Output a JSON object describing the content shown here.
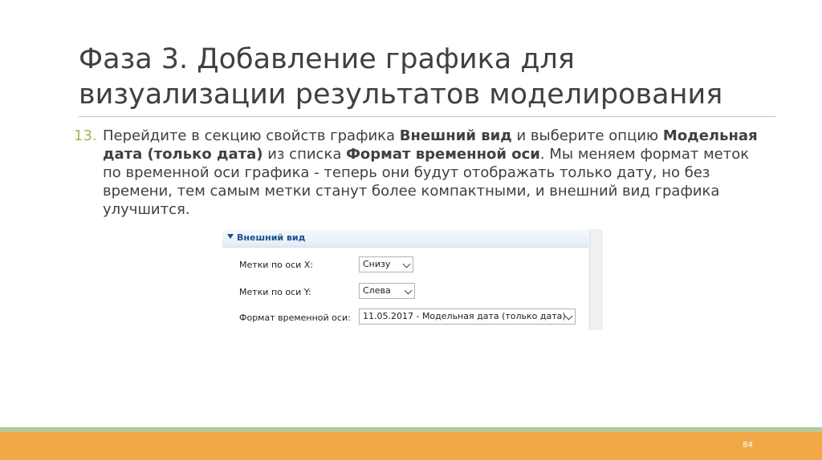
{
  "slide": {
    "title": "Фаза 3. Добавление графика для визуализации результатов моделирования",
    "page_number": "84"
  },
  "step": {
    "number": "13.",
    "t1": "Перейдите в секцию свойств графика ",
    "b1": "Внешний вид",
    "t2": " и выберите опцию ",
    "b2": "Модельная дата (только дата)",
    "t3": " из списка ",
    "b3": "Формат временной оси",
    "t4": ". Мы меняем формат меток по временной оси графика - теперь они будут отображать только дату, но без времени, тем самым метки станут более компактными, и внешний вид графика улучшится."
  },
  "panel": {
    "header": "Внешний вид",
    "rows": [
      {
        "label": "Метки по оси X:",
        "value": "Снизу"
      },
      {
        "label": "Метки по оси Y:",
        "value": "Слева"
      },
      {
        "label": "Формат временной оси:",
        "value": "11.05.2017 - Модельная дата (только дата)"
      }
    ]
  },
  "colors": {
    "accent_green": "#9bbb59",
    "footer_orange": "#f3a848",
    "title_text": "#404040"
  }
}
